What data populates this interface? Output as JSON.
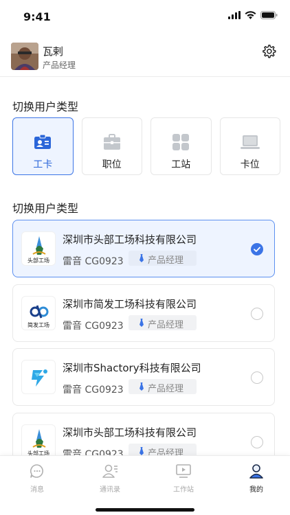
{
  "status_bar": {
    "time": "9:41"
  },
  "profile": {
    "name": "瓦剌",
    "role": "产品经理"
  },
  "user_type_section": {
    "title": "切换用户类型",
    "types": [
      {
        "label": "工卡",
        "icon": "id-card-icon",
        "active": true
      },
      {
        "label": "职位",
        "icon": "briefcase-icon",
        "active": false
      },
      {
        "label": "工站",
        "icon": "grid-icon",
        "active": false
      },
      {
        "label": "卡位",
        "icon": "laptop-icon",
        "active": false
      }
    ]
  },
  "company_section": {
    "title": "切换用户类型",
    "companies": [
      {
        "name": "深圳市头部工场科技有限公司",
        "logo_text": "头部工场",
        "person": "雷音 CG0923",
        "position": "产品经理",
        "selected": true
      },
      {
        "name": "深圳市简发工场科技有限公司",
        "logo_text": "简发工场",
        "person": "雷音 CG0923",
        "position": "产品经理",
        "selected": false
      },
      {
        "name": "深圳市Shactory科技有限公司",
        "logo_text": "",
        "person": "雷音 CG0923",
        "position": "产品经理",
        "selected": false
      },
      {
        "name": "深圳市头部工场科技有限公司",
        "logo_text": "头部工场",
        "person": "雷音 CG0923",
        "position": "产品经理",
        "selected": false
      }
    ]
  },
  "tab_bar": {
    "tabs": [
      {
        "label": "消息",
        "icon": "message-icon",
        "active": false
      },
      {
        "label": "通讯录",
        "icon": "contacts-icon",
        "active": false
      },
      {
        "label": "工作站",
        "icon": "workstation-icon",
        "active": false
      },
      {
        "label": "我的",
        "icon": "profile-icon",
        "active": true
      }
    ]
  },
  "colors": {
    "accent": "#3b74e6",
    "active_bg": "#eef4ff",
    "muted": "#a8a8a8"
  }
}
